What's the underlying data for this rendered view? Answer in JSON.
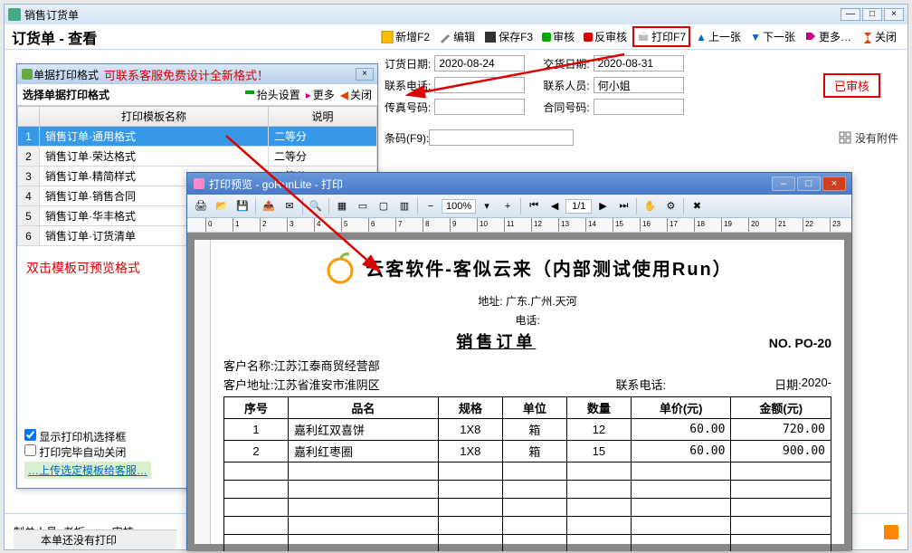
{
  "main_window": {
    "title": "销售订货单"
  },
  "page_header": {
    "title": "订货单 - 查看"
  },
  "toolbar": {
    "new": "新增F2",
    "edit": "编辑",
    "save": "保存F3",
    "audit": "审核",
    "unaudit": "反审核",
    "print": "打印F7",
    "prev": "上一张",
    "next": "下一张",
    "more": "更多…",
    "close": "关闭"
  },
  "form": {
    "order_date_label": "订货日期:",
    "order_date": "2020-08-24",
    "delivery_date_label": "交货日期:",
    "delivery_date": "2020-08-31",
    "contact_phone_label": "联系电话:",
    "contact_phone": "",
    "contact_person_label": "联系人员:",
    "contact_person": "何小姐",
    "fax_label": "传真号码:",
    "fax": "",
    "contract_no_label": "合同号码:",
    "contract_no": "",
    "approved": "已审核",
    "barcode_label": "条码(F9):",
    "no_attachment": "没有附件"
  },
  "footer": {
    "maker_label": "制单人员:",
    "maker": "老板",
    "auditor_label": "审核…",
    "not_printed": "本单还没有打印"
  },
  "template_dialog": {
    "title": "单据打印格式",
    "red_hint": "可联系客服免费设计全新格式！",
    "select_label": "选择单据打印格式",
    "header_btn": "抬头设置",
    "more_btn": "更多",
    "close_btn": "关闭",
    "col_name": "打印模板名称",
    "col_desc": "说明",
    "rows": [
      {
        "name": "销售订单·通用格式",
        "desc": "二等分"
      },
      {
        "name": "销售订单·荣达格式",
        "desc": "二等分"
      },
      {
        "name": "销售订单·精简样式",
        "desc": "二等分"
      },
      {
        "name": "销售订单·销售合同",
        "desc": ""
      },
      {
        "name": "销售订单·华丰格式",
        "desc": ""
      },
      {
        "name": "销售订单·订货清单",
        "desc": ""
      }
    ],
    "dblclick_hint": "双击模板可预览格式",
    "chk_show_selector": "显示打印机选择框",
    "chk_auto_close": "打印完毕自动关闭",
    "upload_link": "…上传选定模板给客服…"
  },
  "preview_window": {
    "title": "打印预览 - goRunLite - 打印",
    "zoom": "100%",
    "page": "1/1",
    "company": "云客软件-客似云来（内部测试使用Run）",
    "addr_label": "地址:",
    "addr": "广东.广州.天河",
    "tel_label": "电话:",
    "tel": "",
    "doc_title": "销售订单",
    "doc_no": "NO. PO-20",
    "cust_name_label": "客户名称:",
    "cust_name": "江苏江泰商贸经营部",
    "cust_addr_label": "客户地址:",
    "cust_addr": "江苏省淮安市淮阴区",
    "contact_tel_label": "联系电话:",
    "contact_tel": "",
    "date_label": "日期:",
    "date": "2020-",
    "table_headers": [
      "序号",
      "品名",
      "规格",
      "单位",
      "数量",
      "单价(元)",
      "金额(元)"
    ],
    "table_rows": [
      {
        "no": "1",
        "name": "嘉利红双喜饼",
        "spec": "1X8",
        "unit": "箱",
        "qty": "12",
        "price": "60.00",
        "amount": "720.00"
      },
      {
        "no": "2",
        "name": "嘉利红枣圈",
        "spec": "1X8",
        "unit": "箱",
        "qty": "15",
        "price": "60.00",
        "amount": "900.00"
      }
    ]
  }
}
